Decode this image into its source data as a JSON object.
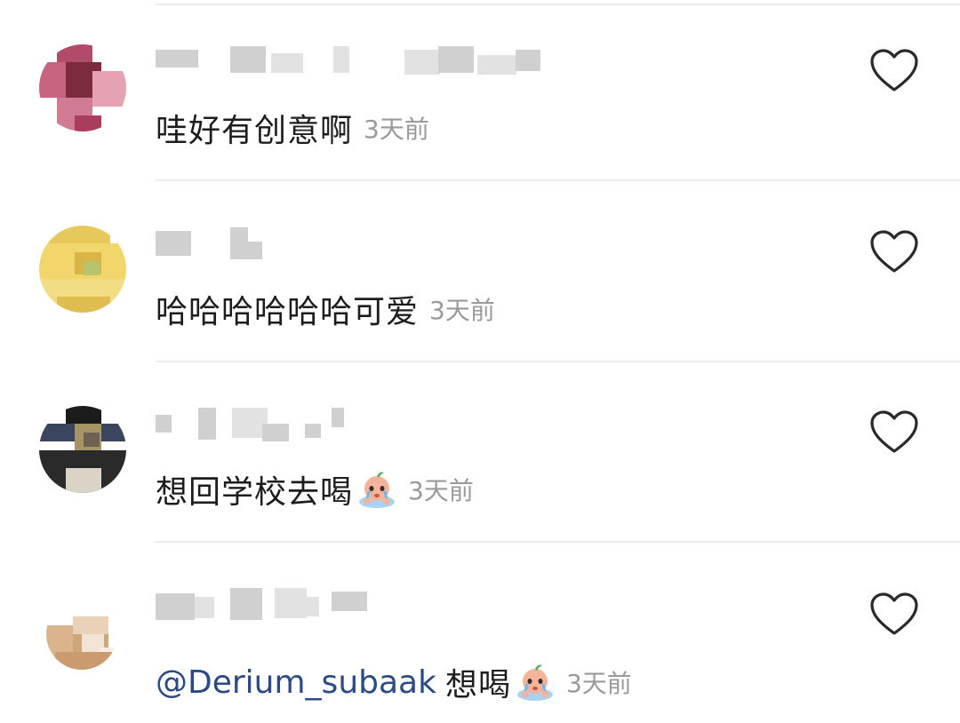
{
  "comments": [
    {
      "username": "",
      "text": "哇好有创意啊",
      "mention": "",
      "has_emoji": false,
      "time": "3天前",
      "avatar_colors": [
        "#b24a6a",
        "#c8637f",
        "#7b2b3c",
        "#e4a3b3",
        "#d27b95",
        "#a83e5c"
      ]
    },
    {
      "username": "",
      "text": "哈哈哈哈哈哈可爱",
      "mention": "",
      "has_emoji": false,
      "time": "3天前",
      "avatar_colors": [
        "#e6c95a",
        "#f0d66b",
        "#d8b545",
        "#b6c46f",
        "#f2dd85",
        "#e0bd4f"
      ]
    },
    {
      "username": "",
      "text": "想回学校去喝",
      "mention": "",
      "has_emoji": true,
      "time": "3天前",
      "avatar_colors": [
        "#1c1c1c",
        "#39465c",
        "#a69465",
        "#6b6251",
        "#2a2a2a",
        "#d9d4c5"
      ]
    },
    {
      "username": "",
      "text": "想喝",
      "mention": "@Derium_subaak",
      "has_emoji": true,
      "time": "3天前",
      "avatar_colors": [
        "#e8d2b8",
        "#cfa57a",
        "#f1e4d4",
        "#d9b48c",
        "#f5ede3",
        "#c99b6e"
      ]
    }
  ],
  "icons": {
    "like": "heart-outline-icon",
    "emoji": "crying-face-emoji-icon"
  },
  "colors": {
    "text": "#1d1d1d",
    "timestamp": "#9a9a9a",
    "mention": "#2b4a86",
    "divider": "#ececec",
    "heart": "#2a2a2a"
  }
}
